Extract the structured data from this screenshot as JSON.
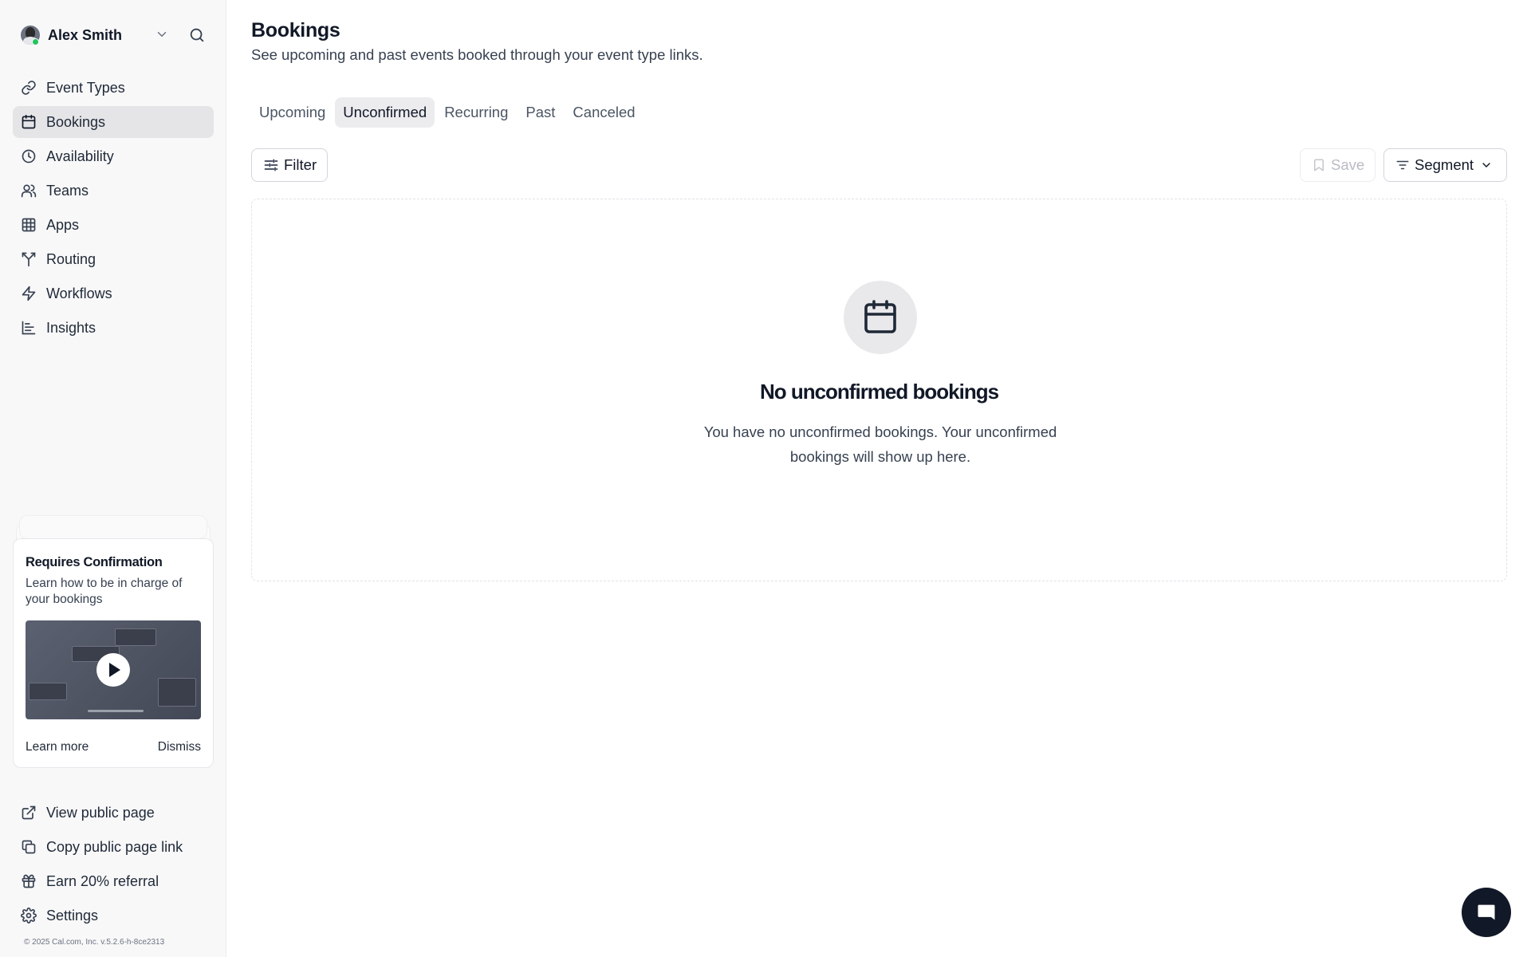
{
  "user": {
    "name": "Alex Smith"
  },
  "sidebar": {
    "items": [
      {
        "label": "Event Types",
        "icon": "link-icon"
      },
      {
        "label": "Bookings",
        "icon": "calendar-icon",
        "active": true
      },
      {
        "label": "Availability",
        "icon": "clock-icon"
      },
      {
        "label": "Teams",
        "icon": "users-icon"
      },
      {
        "label": "Apps",
        "icon": "grid-icon"
      },
      {
        "label": "Routing",
        "icon": "split-icon"
      },
      {
        "label": "Workflows",
        "icon": "zap-icon"
      },
      {
        "label": "Insights",
        "icon": "chart-icon"
      }
    ],
    "bottom_items": [
      {
        "label": "View public page",
        "icon": "external-link-icon"
      },
      {
        "label": "Copy public page link",
        "icon": "copy-icon"
      },
      {
        "label": "Earn 20% referral",
        "icon": "gift-icon"
      },
      {
        "label": "Settings",
        "icon": "gear-icon"
      }
    ],
    "footer": "© 2025 Cal.com, Inc. v.5.2.6-h-8ce2313"
  },
  "promo": {
    "title": "Requires Confirmation",
    "text": "Learn how to be in charge of your bookings",
    "learn_more": "Learn more",
    "dismiss": "Dismiss"
  },
  "header": {
    "title": "Bookings",
    "subtitle": "See upcoming and past events booked through your event type links."
  },
  "tabs": [
    {
      "label": "Upcoming"
    },
    {
      "label": "Unconfirmed",
      "active": true
    },
    {
      "label": "Recurring"
    },
    {
      "label": "Past"
    },
    {
      "label": "Canceled"
    }
  ],
  "toolbar": {
    "filter": "Filter",
    "save": "Save",
    "segment": "Segment"
  },
  "empty_state": {
    "title": "No unconfirmed bookings",
    "text": "You have no unconfirmed bookings. Your unconfirmed bookings will show up here."
  },
  "colors": {
    "accent": "#111827",
    "sidebar_bg": "#f8f8f9",
    "active_bg": "#e5e5e8",
    "online": "#22c55e"
  }
}
